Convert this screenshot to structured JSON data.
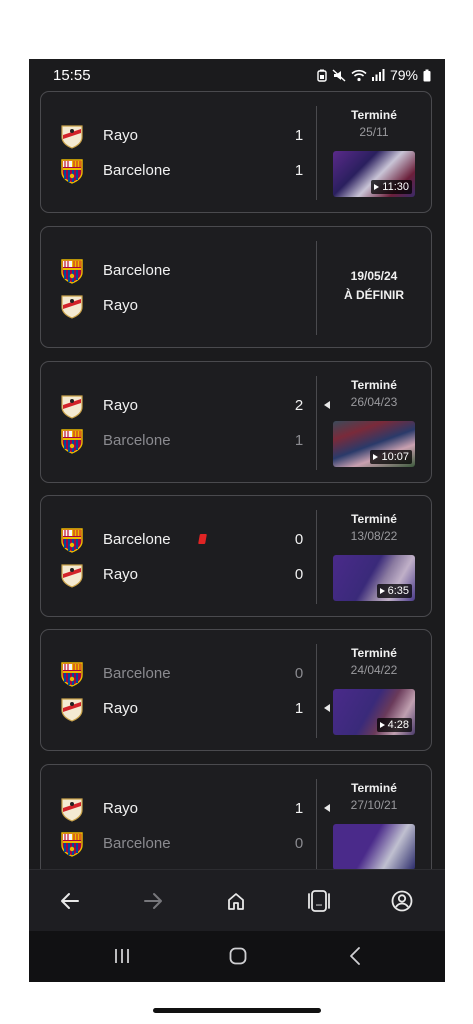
{
  "status_bar": {
    "time": "15:55",
    "battery": "79%"
  },
  "matches": [
    {
      "home": {
        "name": "Rayo",
        "crest": "rayo",
        "score": "1",
        "dim": false,
        "win": false
      },
      "away": {
        "name": "Barcelone",
        "crest": "barca",
        "score": "1",
        "dim": false,
        "win": false
      },
      "status": "Terminé",
      "date": "25/11",
      "video_duration": "11:30"
    },
    {
      "home": {
        "name": "Barcelone",
        "crest": "barca",
        "score": "",
        "dim": false,
        "win": false
      },
      "away": {
        "name": "Rayo",
        "crest": "rayo",
        "score": "",
        "dim": false,
        "win": false
      },
      "status": "",
      "date": "19/05/24",
      "status_tbd": "À DÉFINIR",
      "video_duration": ""
    },
    {
      "home": {
        "name": "Rayo",
        "crest": "rayo",
        "score": "2",
        "dim": false,
        "win": true
      },
      "away": {
        "name": "Barcelone",
        "crest": "barca",
        "score": "1",
        "dim": true,
        "win": false
      },
      "status": "Terminé",
      "date": "26/04/23",
      "video_duration": "10:07"
    },
    {
      "home": {
        "name": "Barcelone",
        "crest": "barca",
        "score": "0",
        "dim": false,
        "win": false,
        "red_card": true
      },
      "away": {
        "name": "Rayo",
        "crest": "rayo",
        "score": "0",
        "dim": false,
        "win": false
      },
      "status": "Terminé",
      "date": "13/08/22",
      "video_duration": "6:35"
    },
    {
      "home": {
        "name": "Barcelone",
        "crest": "barca",
        "score": "0",
        "dim": true,
        "win": false
      },
      "away": {
        "name": "Rayo",
        "crest": "rayo",
        "score": "1",
        "dim": false,
        "win": true
      },
      "status": "Terminé",
      "date": "24/04/22",
      "video_duration": "4:28"
    },
    {
      "home": {
        "name": "Rayo",
        "crest": "rayo",
        "score": "1",
        "dim": false,
        "win": true
      },
      "away": {
        "name": "Barcelone",
        "crest": "barca",
        "score": "0",
        "dim": true,
        "win": false
      },
      "status": "Terminé",
      "date": "27/10/21",
      "video_duration": ""
    }
  ],
  "nav": {
    "items": [
      "back-arrow-icon",
      "forward-arrow-icon",
      "home-icon",
      "tabs-icon",
      "account-icon"
    ]
  },
  "system_nav": {
    "items": [
      "recents-icon",
      "home-circle-icon",
      "back-chevron-icon"
    ]
  },
  "colors": {
    "background": "#1b1b1d",
    "card_border": "#4a4a4e",
    "text": "#f1f1f1",
    "dim_text": "#8a8a8f",
    "red_card": "#e02424"
  }
}
